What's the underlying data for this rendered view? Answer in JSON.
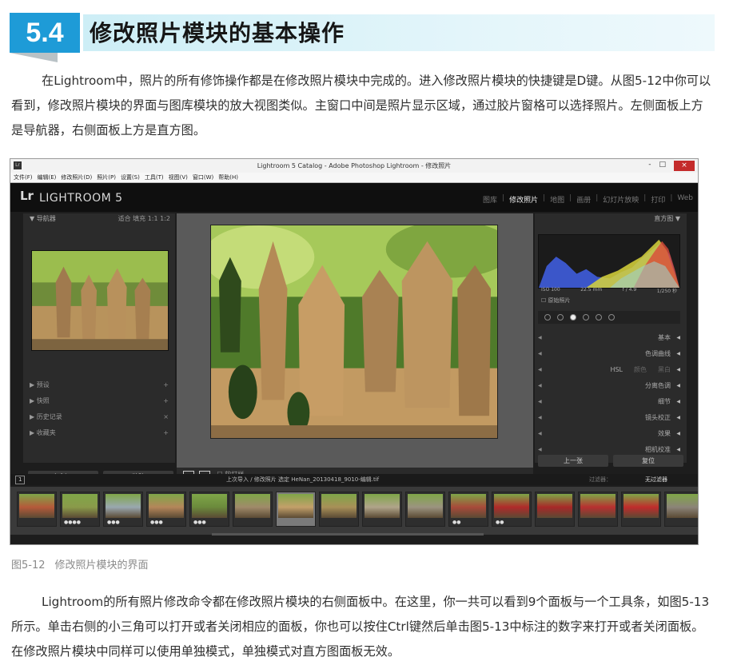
{
  "section": {
    "number": "5.4",
    "title": "修改照片模块的基本操作"
  },
  "para1": "在Lightroom中，照片的所有修饰操作都是在修改照片模块中完成的。进入修改照片模块的快捷键是D键。从图5-12中你可以看到，修改照片模块的界面与图库模块的放大视图类似。主窗口中间是照片显示区域，通过胶片窗格可以选择照片。左侧面板上方是导航器，右侧面板上方是直方图。",
  "caption": {
    "label": "图5-12",
    "text": "修改照片模块的界面"
  },
  "para2": "Lightroom的所有照片修改命令都在修改照片模块的右侧面板中。在这里，你一共可以看到9个面板与一个工具条，如图5-13所示。单击右侧的小三角可以打开或者关闭相应的面板，你也可以按住Ctrl键然后单击图5-13中标注的数字来打开或者关闭面板。在修改照片模块中同样可以使用单独模式，单独模式对直方图面板无效。",
  "lightroom": {
    "window_title": "Lightroom 5 Catalog - Adobe Photoshop Lightroom - 修改照片",
    "app_icon": "Lr",
    "window_buttons": [
      "-",
      "□",
      "×"
    ],
    "menu": [
      "文件(F)",
      "编辑(E)",
      "修改照片(D)",
      "照片(P)",
      "设置(S)",
      "工具(T)",
      "视图(V)",
      "窗口(W)",
      "帮助(H)"
    ],
    "logo": "Lr",
    "product": "LIGHTROOM 5",
    "modules": [
      "图库",
      "修改照片",
      "地图",
      "画册",
      "幻灯片放映",
      "打印",
      "Web"
    ],
    "active_module": "修改照片",
    "navigator": {
      "title": "导航器",
      "zoom": "适合  填充  1:1  1:2"
    },
    "left_panels": [
      {
        "label": "预设",
        "mark": "+"
      },
      {
        "label": "快照",
        "mark": "+"
      },
      {
        "label": "历史记录",
        "mark": "×"
      },
      {
        "label": "收藏夹",
        "mark": "+"
      }
    ],
    "left_buttons": [
      "复制...",
      "粘贴"
    ],
    "toolbar": {
      "soft_proof": "软打样"
    },
    "histogram": {
      "title": "直方图",
      "info": [
        "ISO 100",
        "22.5 mm",
        "f / 4.9",
        "1/250 秒"
      ],
      "original_photo": "原始照片"
    },
    "right_panels": [
      "基本",
      "色调曲线",
      "分离色调",
      "细节",
      "镜头校正",
      "效果",
      "相机校准"
    ],
    "hsl": {
      "label": "HSL",
      "a": "颜色",
      "b": "黑白"
    },
    "right_buttons": [
      "上一张",
      "复位"
    ],
    "filmstrip": {
      "page": "1",
      "breadcrumb": "上次导入 / 修改照片   选定  HeNan_20130418_9010-编辑.tif",
      "filter_label": "过滤器：",
      "filter_value": "无过滤器"
    }
  }
}
